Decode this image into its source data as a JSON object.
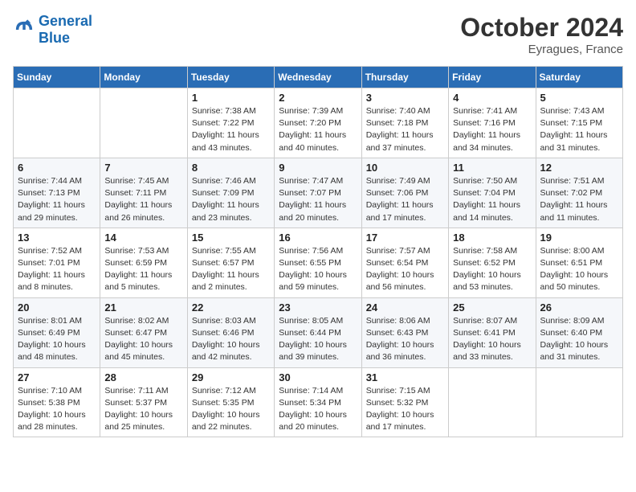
{
  "header": {
    "logo_line1": "General",
    "logo_line2": "Blue",
    "month": "October 2024",
    "location": "Eyragues, France"
  },
  "weekdays": [
    "Sunday",
    "Monday",
    "Tuesday",
    "Wednesday",
    "Thursday",
    "Friday",
    "Saturday"
  ],
  "weeks": [
    [
      {
        "day": "",
        "sunrise": "",
        "sunset": "",
        "daylight": ""
      },
      {
        "day": "",
        "sunrise": "",
        "sunset": "",
        "daylight": ""
      },
      {
        "day": "1",
        "sunrise": "Sunrise: 7:38 AM",
        "sunset": "Sunset: 7:22 PM",
        "daylight": "Daylight: 11 hours and 43 minutes."
      },
      {
        "day": "2",
        "sunrise": "Sunrise: 7:39 AM",
        "sunset": "Sunset: 7:20 PM",
        "daylight": "Daylight: 11 hours and 40 minutes."
      },
      {
        "day": "3",
        "sunrise": "Sunrise: 7:40 AM",
        "sunset": "Sunset: 7:18 PM",
        "daylight": "Daylight: 11 hours and 37 minutes."
      },
      {
        "day": "4",
        "sunrise": "Sunrise: 7:41 AM",
        "sunset": "Sunset: 7:16 PM",
        "daylight": "Daylight: 11 hours and 34 minutes."
      },
      {
        "day": "5",
        "sunrise": "Sunrise: 7:43 AM",
        "sunset": "Sunset: 7:15 PM",
        "daylight": "Daylight: 11 hours and 31 minutes."
      }
    ],
    [
      {
        "day": "6",
        "sunrise": "Sunrise: 7:44 AM",
        "sunset": "Sunset: 7:13 PM",
        "daylight": "Daylight: 11 hours and 29 minutes."
      },
      {
        "day": "7",
        "sunrise": "Sunrise: 7:45 AM",
        "sunset": "Sunset: 7:11 PM",
        "daylight": "Daylight: 11 hours and 26 minutes."
      },
      {
        "day": "8",
        "sunrise": "Sunrise: 7:46 AM",
        "sunset": "Sunset: 7:09 PM",
        "daylight": "Daylight: 11 hours and 23 minutes."
      },
      {
        "day": "9",
        "sunrise": "Sunrise: 7:47 AM",
        "sunset": "Sunset: 7:07 PM",
        "daylight": "Daylight: 11 hours and 20 minutes."
      },
      {
        "day": "10",
        "sunrise": "Sunrise: 7:49 AM",
        "sunset": "Sunset: 7:06 PM",
        "daylight": "Daylight: 11 hours and 17 minutes."
      },
      {
        "day": "11",
        "sunrise": "Sunrise: 7:50 AM",
        "sunset": "Sunset: 7:04 PM",
        "daylight": "Daylight: 11 hours and 14 minutes."
      },
      {
        "day": "12",
        "sunrise": "Sunrise: 7:51 AM",
        "sunset": "Sunset: 7:02 PM",
        "daylight": "Daylight: 11 hours and 11 minutes."
      }
    ],
    [
      {
        "day": "13",
        "sunrise": "Sunrise: 7:52 AM",
        "sunset": "Sunset: 7:01 PM",
        "daylight": "Daylight: 11 hours and 8 minutes."
      },
      {
        "day": "14",
        "sunrise": "Sunrise: 7:53 AM",
        "sunset": "Sunset: 6:59 PM",
        "daylight": "Daylight: 11 hours and 5 minutes."
      },
      {
        "day": "15",
        "sunrise": "Sunrise: 7:55 AM",
        "sunset": "Sunset: 6:57 PM",
        "daylight": "Daylight: 11 hours and 2 minutes."
      },
      {
        "day": "16",
        "sunrise": "Sunrise: 7:56 AM",
        "sunset": "Sunset: 6:55 PM",
        "daylight": "Daylight: 10 hours and 59 minutes."
      },
      {
        "day": "17",
        "sunrise": "Sunrise: 7:57 AM",
        "sunset": "Sunset: 6:54 PM",
        "daylight": "Daylight: 10 hours and 56 minutes."
      },
      {
        "day": "18",
        "sunrise": "Sunrise: 7:58 AM",
        "sunset": "Sunset: 6:52 PM",
        "daylight": "Daylight: 10 hours and 53 minutes."
      },
      {
        "day": "19",
        "sunrise": "Sunrise: 8:00 AM",
        "sunset": "Sunset: 6:51 PM",
        "daylight": "Daylight: 10 hours and 50 minutes."
      }
    ],
    [
      {
        "day": "20",
        "sunrise": "Sunrise: 8:01 AM",
        "sunset": "Sunset: 6:49 PM",
        "daylight": "Daylight: 10 hours and 48 minutes."
      },
      {
        "day": "21",
        "sunrise": "Sunrise: 8:02 AM",
        "sunset": "Sunset: 6:47 PM",
        "daylight": "Daylight: 10 hours and 45 minutes."
      },
      {
        "day": "22",
        "sunrise": "Sunrise: 8:03 AM",
        "sunset": "Sunset: 6:46 PM",
        "daylight": "Daylight: 10 hours and 42 minutes."
      },
      {
        "day": "23",
        "sunrise": "Sunrise: 8:05 AM",
        "sunset": "Sunset: 6:44 PM",
        "daylight": "Daylight: 10 hours and 39 minutes."
      },
      {
        "day": "24",
        "sunrise": "Sunrise: 8:06 AM",
        "sunset": "Sunset: 6:43 PM",
        "daylight": "Daylight: 10 hours and 36 minutes."
      },
      {
        "day": "25",
        "sunrise": "Sunrise: 8:07 AM",
        "sunset": "Sunset: 6:41 PM",
        "daylight": "Daylight: 10 hours and 33 minutes."
      },
      {
        "day": "26",
        "sunrise": "Sunrise: 8:09 AM",
        "sunset": "Sunset: 6:40 PM",
        "daylight": "Daylight: 10 hours and 31 minutes."
      }
    ],
    [
      {
        "day": "27",
        "sunrise": "Sunrise: 7:10 AM",
        "sunset": "Sunset: 5:38 PM",
        "daylight": "Daylight: 10 hours and 28 minutes."
      },
      {
        "day": "28",
        "sunrise": "Sunrise: 7:11 AM",
        "sunset": "Sunset: 5:37 PM",
        "daylight": "Daylight: 10 hours and 25 minutes."
      },
      {
        "day": "29",
        "sunrise": "Sunrise: 7:12 AM",
        "sunset": "Sunset: 5:35 PM",
        "daylight": "Daylight: 10 hours and 22 minutes."
      },
      {
        "day": "30",
        "sunrise": "Sunrise: 7:14 AM",
        "sunset": "Sunset: 5:34 PM",
        "daylight": "Daylight: 10 hours and 20 minutes."
      },
      {
        "day": "31",
        "sunrise": "Sunrise: 7:15 AM",
        "sunset": "Sunset: 5:32 PM",
        "daylight": "Daylight: 10 hours and 17 minutes."
      },
      {
        "day": "",
        "sunrise": "",
        "sunset": "",
        "daylight": ""
      },
      {
        "day": "",
        "sunrise": "",
        "sunset": "",
        "daylight": ""
      }
    ]
  ]
}
